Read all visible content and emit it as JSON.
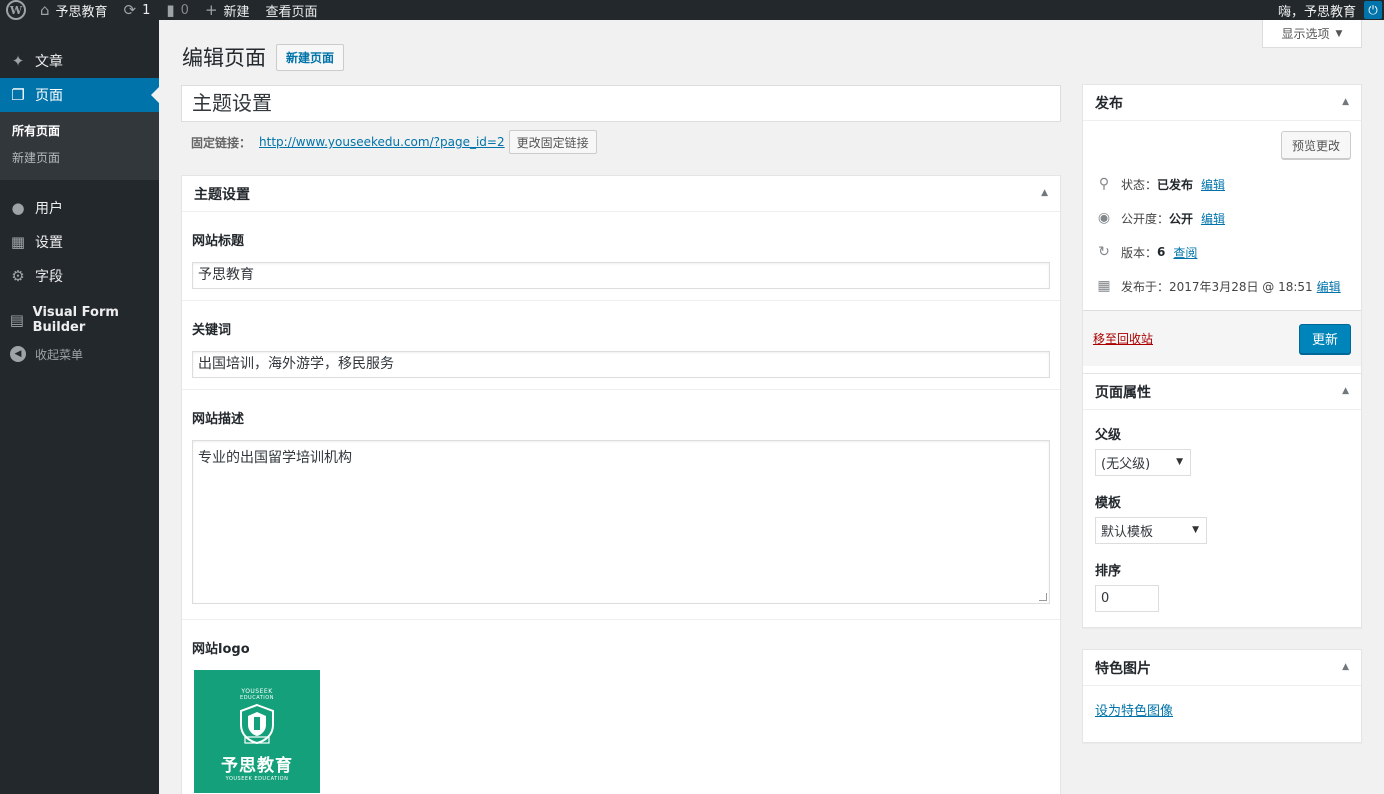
{
  "adminbar": {
    "site_name": "予思教育",
    "updates_count": "1",
    "comments_count": "0",
    "new_label": "新建",
    "view_page": "查看页面",
    "greeting": "嗨，予思教育"
  },
  "sidebar": {
    "items": [
      {
        "label": "文章",
        "icon": "pin-icon"
      },
      {
        "label": "页面",
        "icon": "pages-icon"
      },
      {
        "label": "用户",
        "icon": "user-icon"
      },
      {
        "label": "设置",
        "icon": "settings-icon"
      },
      {
        "label": "字段",
        "icon": "gear-icon"
      },
      {
        "label": "Visual Form Builder",
        "icon": "form-icon"
      },
      {
        "label": "收起菜单",
        "icon": "collapse-icon"
      }
    ],
    "submenu": [
      {
        "label": "所有页面"
      },
      {
        "label": "新建页面"
      }
    ]
  },
  "main": {
    "screen_options": "显示选项",
    "page_title": "编辑页面",
    "add_new": "新建页面",
    "post_title": "主题设置",
    "permalink_label": "固定链接：",
    "permalink_url": "http://www.youseekedu.com/?page_id=2",
    "permalink_button": "更改固定链接",
    "metabox_title": "主题设置",
    "fields": {
      "site_title_label": "网站标题",
      "site_title_value": "予思教育",
      "keywords_label": "关键词",
      "keywords_value": "出国培训，海外游学，移民服务",
      "description_label": "网站描述",
      "description_value": "专业的出国留学培训机构",
      "logo_label": "网站logo"
    },
    "logo": {
      "top": "YOUSEEK",
      "sub": "EDUCATION",
      "cn": "予思教育",
      "en": "YOUSEEK EDUCATION"
    }
  },
  "publish": {
    "title": "发布",
    "preview": "预览更改",
    "status_label": "状态：",
    "status_value": "已发布",
    "visibility_label": "公开度：",
    "visibility_value": "公开",
    "revisions_label": "版本：",
    "revisions_value": "6",
    "revisions_link": "查阅",
    "published_label": "发布于：",
    "published_value": "2017年3月28日 @ 18:51",
    "edit": "编辑",
    "trash": "移至回收站",
    "update": "更新"
  },
  "page_attributes": {
    "title": "页面属性",
    "parent_label": "父级",
    "parent_value": "(无父级)",
    "template_label": "模板",
    "template_value": "默认模板",
    "order_label": "排序",
    "order_value": "0"
  },
  "featured_image": {
    "title": "特色图片",
    "set_link": "设为特色图像"
  }
}
